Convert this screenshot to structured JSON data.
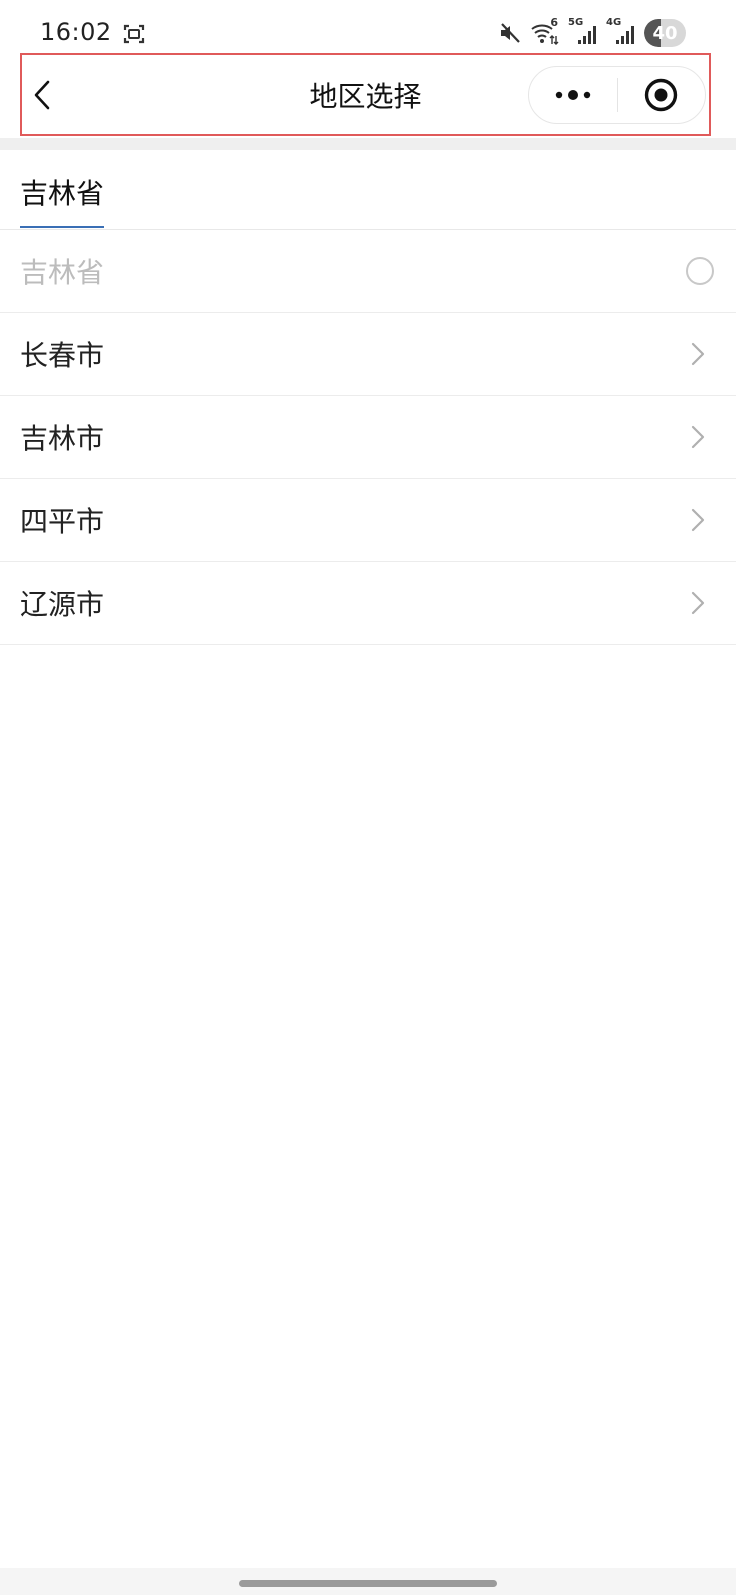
{
  "status_bar": {
    "time": "16:02",
    "battery_level": "40",
    "icons": [
      "screenshot-indicator-icon",
      "mute-icon",
      "wifi-icon",
      "5g-signal-icon",
      "4g-signal-icon",
      "battery-icon"
    ],
    "wifi_badge": "6",
    "signal_5g_label": "5G",
    "signal_4g_label": "4G"
  },
  "nav": {
    "title": "地区选择",
    "back_icon": "chevron-left-icon",
    "more_icon": "more-dots-icon",
    "close_icon": "target-close-icon"
  },
  "tabs": [
    {
      "label": "吉林省",
      "active": true
    }
  ],
  "list": {
    "selectable_item": {
      "label": "吉林省",
      "icon": "radio-icon"
    },
    "items": [
      {
        "label": "长春市",
        "icon": "chevron-right-icon"
      },
      {
        "label": "吉林市",
        "icon": "chevron-right-icon"
      },
      {
        "label": "四平市",
        "icon": "chevron-right-icon"
      },
      {
        "label": "辽源市",
        "icon": "chevron-right-icon"
      }
    ]
  },
  "colors": {
    "tab_underline": "#3a6fb5",
    "highlight_border": "#e05a5a",
    "disabled_text": "#bcbcbc"
  }
}
